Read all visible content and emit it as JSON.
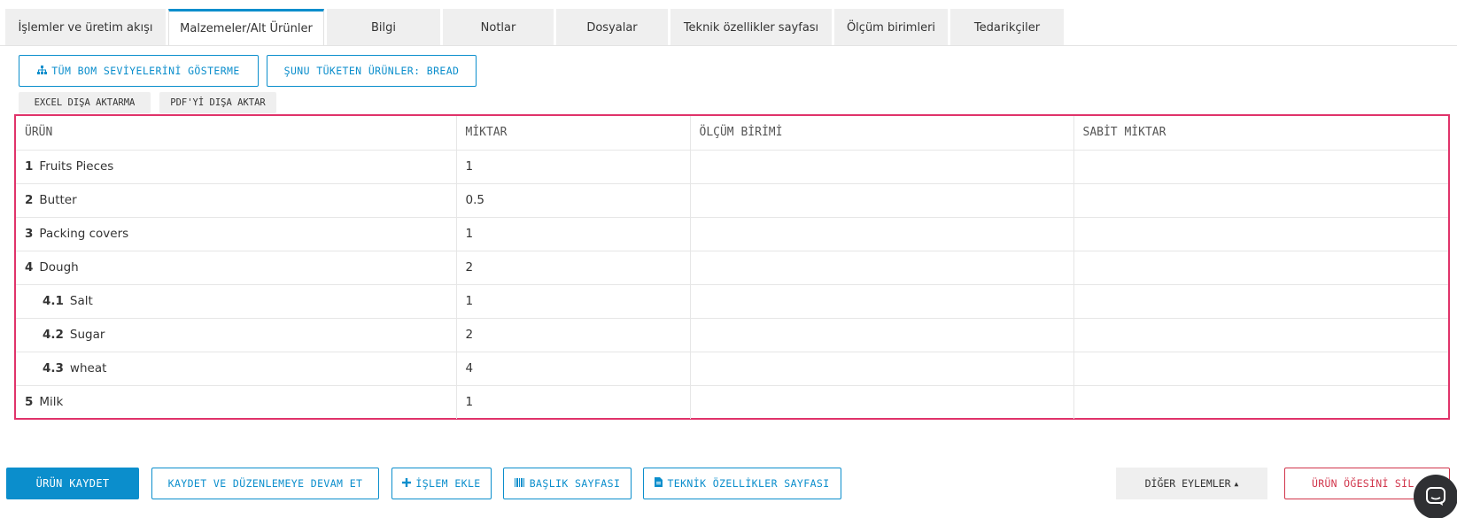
{
  "tabs": [
    {
      "label": "İşlemler ve üretim akışı"
    },
    {
      "label": "Malzemeler/Alt Ürünler"
    },
    {
      "label": "Bilgi"
    },
    {
      "label": "Notlar"
    },
    {
      "label": "Dosyalar"
    },
    {
      "label": "Teknik özellikler sayfası"
    },
    {
      "label": "Ölçüm birimleri"
    },
    {
      "label": "Tedarikçiler"
    }
  ],
  "toolbar": {
    "show_bom_label": "TÜM BOM SEVİYELERİNİ GÖSTERME",
    "consumers_label": "ŞUNU TÜKETEN ÜRÜNLER: BREAD",
    "excel_label": "EXCEL DIŞA AKTARMA",
    "pdf_label": "PDF'Yİ DIŞA AKTAR"
  },
  "table": {
    "columns": [
      "ÜRÜN",
      "MİKTAR",
      "ÖLÇÜM BİRİMİ",
      "SABİT MİKTAR"
    ],
    "rows": [
      {
        "num": "1",
        "name": "Fruits Pieces",
        "qty": "1",
        "unit": "",
        "fixed": ""
      },
      {
        "num": "2",
        "name": "Butter",
        "qty": "0.5",
        "unit": "",
        "fixed": ""
      },
      {
        "num": "3",
        "name": "Packing covers",
        "qty": "1",
        "unit": "",
        "fixed": ""
      },
      {
        "num": "4",
        "name": "Dough",
        "qty": "2",
        "unit": "",
        "fixed": ""
      },
      {
        "num": "4.1",
        "name": "Salt",
        "qty": "1",
        "unit": "",
        "fixed": ""
      },
      {
        "num": "4.2",
        "name": "Sugar",
        "qty": "2",
        "unit": "",
        "fixed": ""
      },
      {
        "num": "4.3",
        "name": "wheat",
        "qty": "4",
        "unit": "",
        "fixed": ""
      },
      {
        "num": "5",
        "name": "Milk",
        "qty": "1",
        "unit": "",
        "fixed": ""
      }
    ]
  },
  "footer": {
    "save_label": "ÜRÜN KAYDET",
    "save_continue_label": "KAYDET VE DÜZENLEMEYE DEVAM ET",
    "add_operation_label": "İŞLEM EKLE",
    "header_page_label": "BAŞLIK SAYFASI",
    "spec_page_label": "TEKNİK ÖZELLİKLER SAYFASI",
    "other_actions_label": "DİĞER EYLEMLER",
    "delete_label": "ÜRÜN ÖĞESİNİ SİL"
  },
  "colors": {
    "accent": "#0b8ecc",
    "danger": "#d1354b",
    "highlight": "#e0336a"
  },
  "icons": {
    "bom": "sitemap-icon",
    "add": "plus-icon",
    "header": "barcode-icon",
    "spec": "file-icon",
    "caret": "caret-up-icon",
    "chat": "chat-icon"
  }
}
